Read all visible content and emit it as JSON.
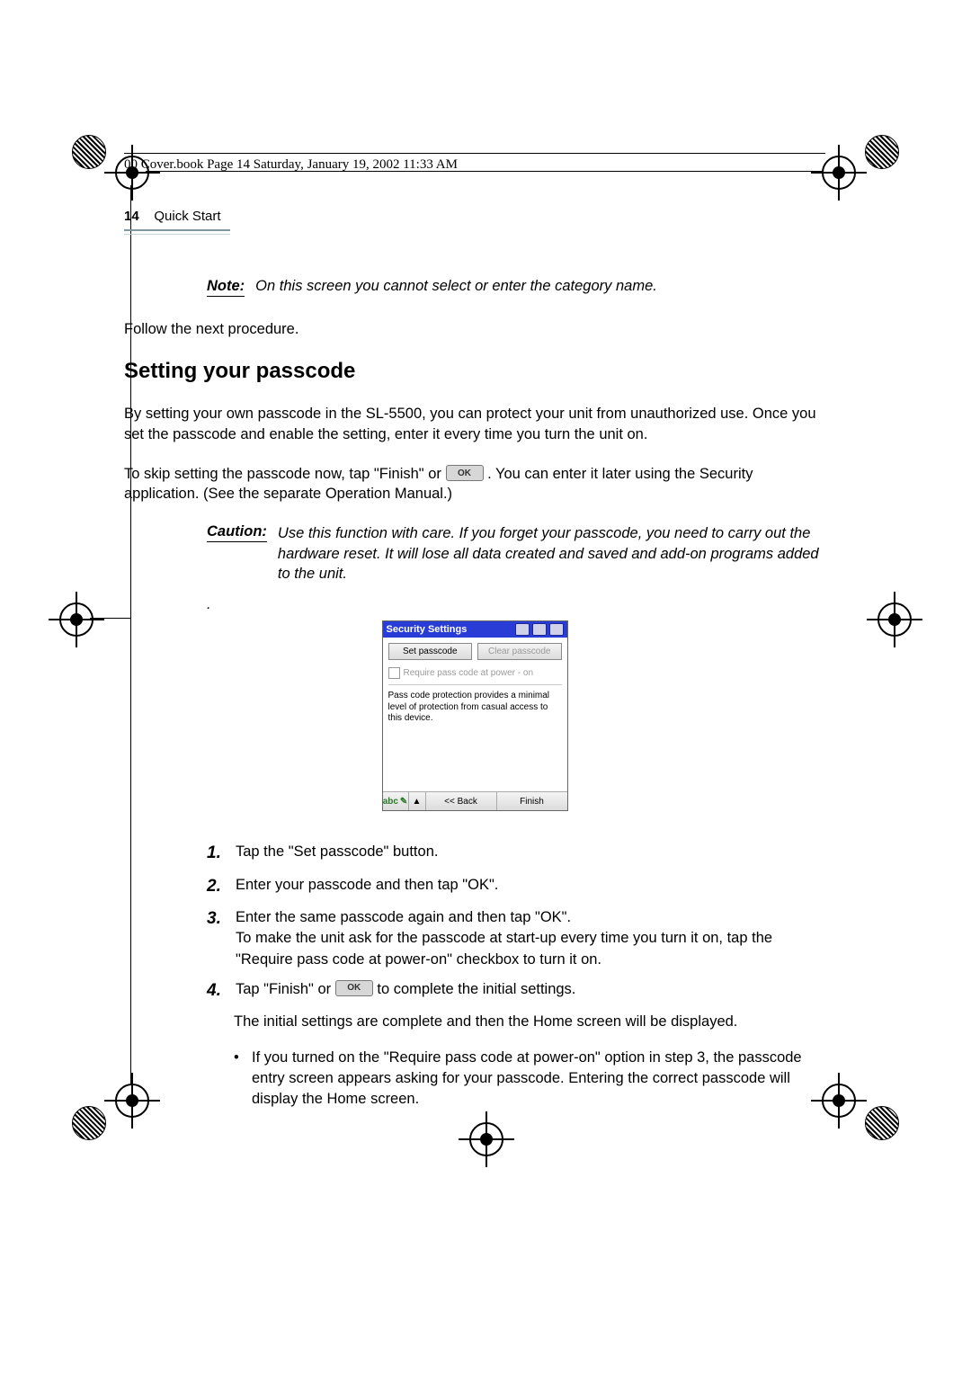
{
  "header_line": "00 Cover.book  Page 14  Saturday, January 19, 2002  11:33 AM",
  "running_head": {
    "page_number": "14",
    "section": "Quick Start"
  },
  "note": {
    "label": "Note:",
    "text": "On this screen you cannot select or enter the category name."
  },
  "follow_text": "Follow the next procedure.",
  "section_title": "Setting your passcode",
  "intro_para1": "By setting your own passcode in the SL-5500, you can protect your unit from unauthorized use. Once you set the passcode and enable the setting, enter it every time you turn the unit on.",
  "intro_para2_a": "To skip setting the passcode now, tap \"Finish\" or ",
  "intro_para2_b": ". You can enter it later using the Security application. (See the separate Operation Manual.)",
  "ok_chip": "OK",
  "caution": {
    "label": "Caution:",
    "text": "Use this function with care. If you forget your passcode, you need to carry out the hardware reset. It will lose all data created and saved and add-on programs added to the unit."
  },
  "dot": ".",
  "device": {
    "title": "Security Settings",
    "btn_set": "Set passcode",
    "btn_clear": "Clear passcode",
    "checkbox_label": "Require pass code at power - on",
    "description": "Pass code protection provides a minimal level of protection from casual access to this device.",
    "bottom_abc": "abc",
    "bottom_arrow": "▲",
    "bottom_back": "<< Back",
    "bottom_finish": "Finish"
  },
  "steps": {
    "s1": "Tap the \"Set passcode\" button.",
    "s2": "Enter your passcode and then tap \"OK\".",
    "s3a": "Enter the same passcode again and then tap \"OK\".",
    "s3b": "To make the unit ask for the passcode at start-up every time you turn it on, tap the \"Require pass code at power-on\" checkbox to turn it on.",
    "s4a": "Tap \"Finish\" or ",
    "s4b": " to  complete the initial settings."
  },
  "after_steps": "The initial settings are complete and then the Home screen will be displayed.",
  "bullet": "If you turned on the \"Require pass code at power-on\" option in step 3, the passcode entry screen appears asking for your passcode. Entering the correct passcode will display the Home screen."
}
